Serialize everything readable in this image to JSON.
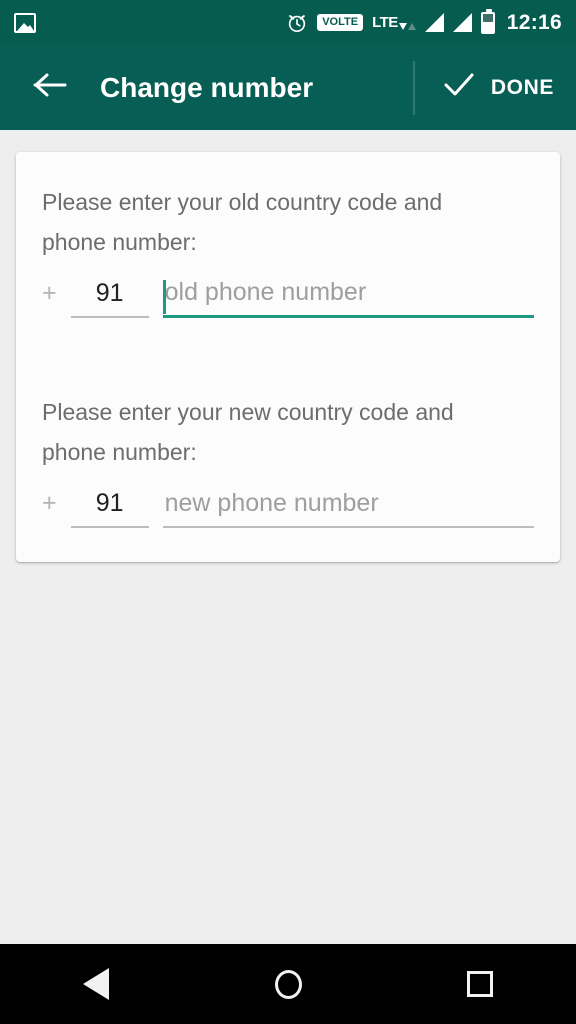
{
  "status_bar": {
    "notification_icon": "photo-icon",
    "icons": [
      "alarm-icon",
      "volte-icon",
      "lte-icon",
      "signal-icon",
      "signal-icon",
      "battery-icon"
    ],
    "volte_label": "VOLTE",
    "lte_label": "LTE",
    "battery_level_percent": 55,
    "time": "12:16",
    "background_color": "#075c50"
  },
  "app_bar": {
    "back_icon": "arrow-left-icon",
    "title": "Change number",
    "done_icon": "check-icon",
    "done_label": "DONE",
    "background_color": "#075e54"
  },
  "form": {
    "old": {
      "label": "Please enter your old country code and phone number:",
      "plus": "+",
      "country_code": "91",
      "phone_placeholder": "old phone number",
      "phone_value": "",
      "focused": true,
      "accent_color": "#1d9b82"
    },
    "new": {
      "label": "Please enter your new country code and phone number:",
      "plus": "+",
      "country_code": "91",
      "phone_placeholder": "new phone number",
      "phone_value": "",
      "focused": false,
      "underline_color": "#bdbdbd"
    }
  },
  "nav_bar": {
    "back": "triangle-back-icon",
    "home": "circle-home-icon",
    "recents": "square-recents-icon",
    "background_color": "#000000"
  }
}
